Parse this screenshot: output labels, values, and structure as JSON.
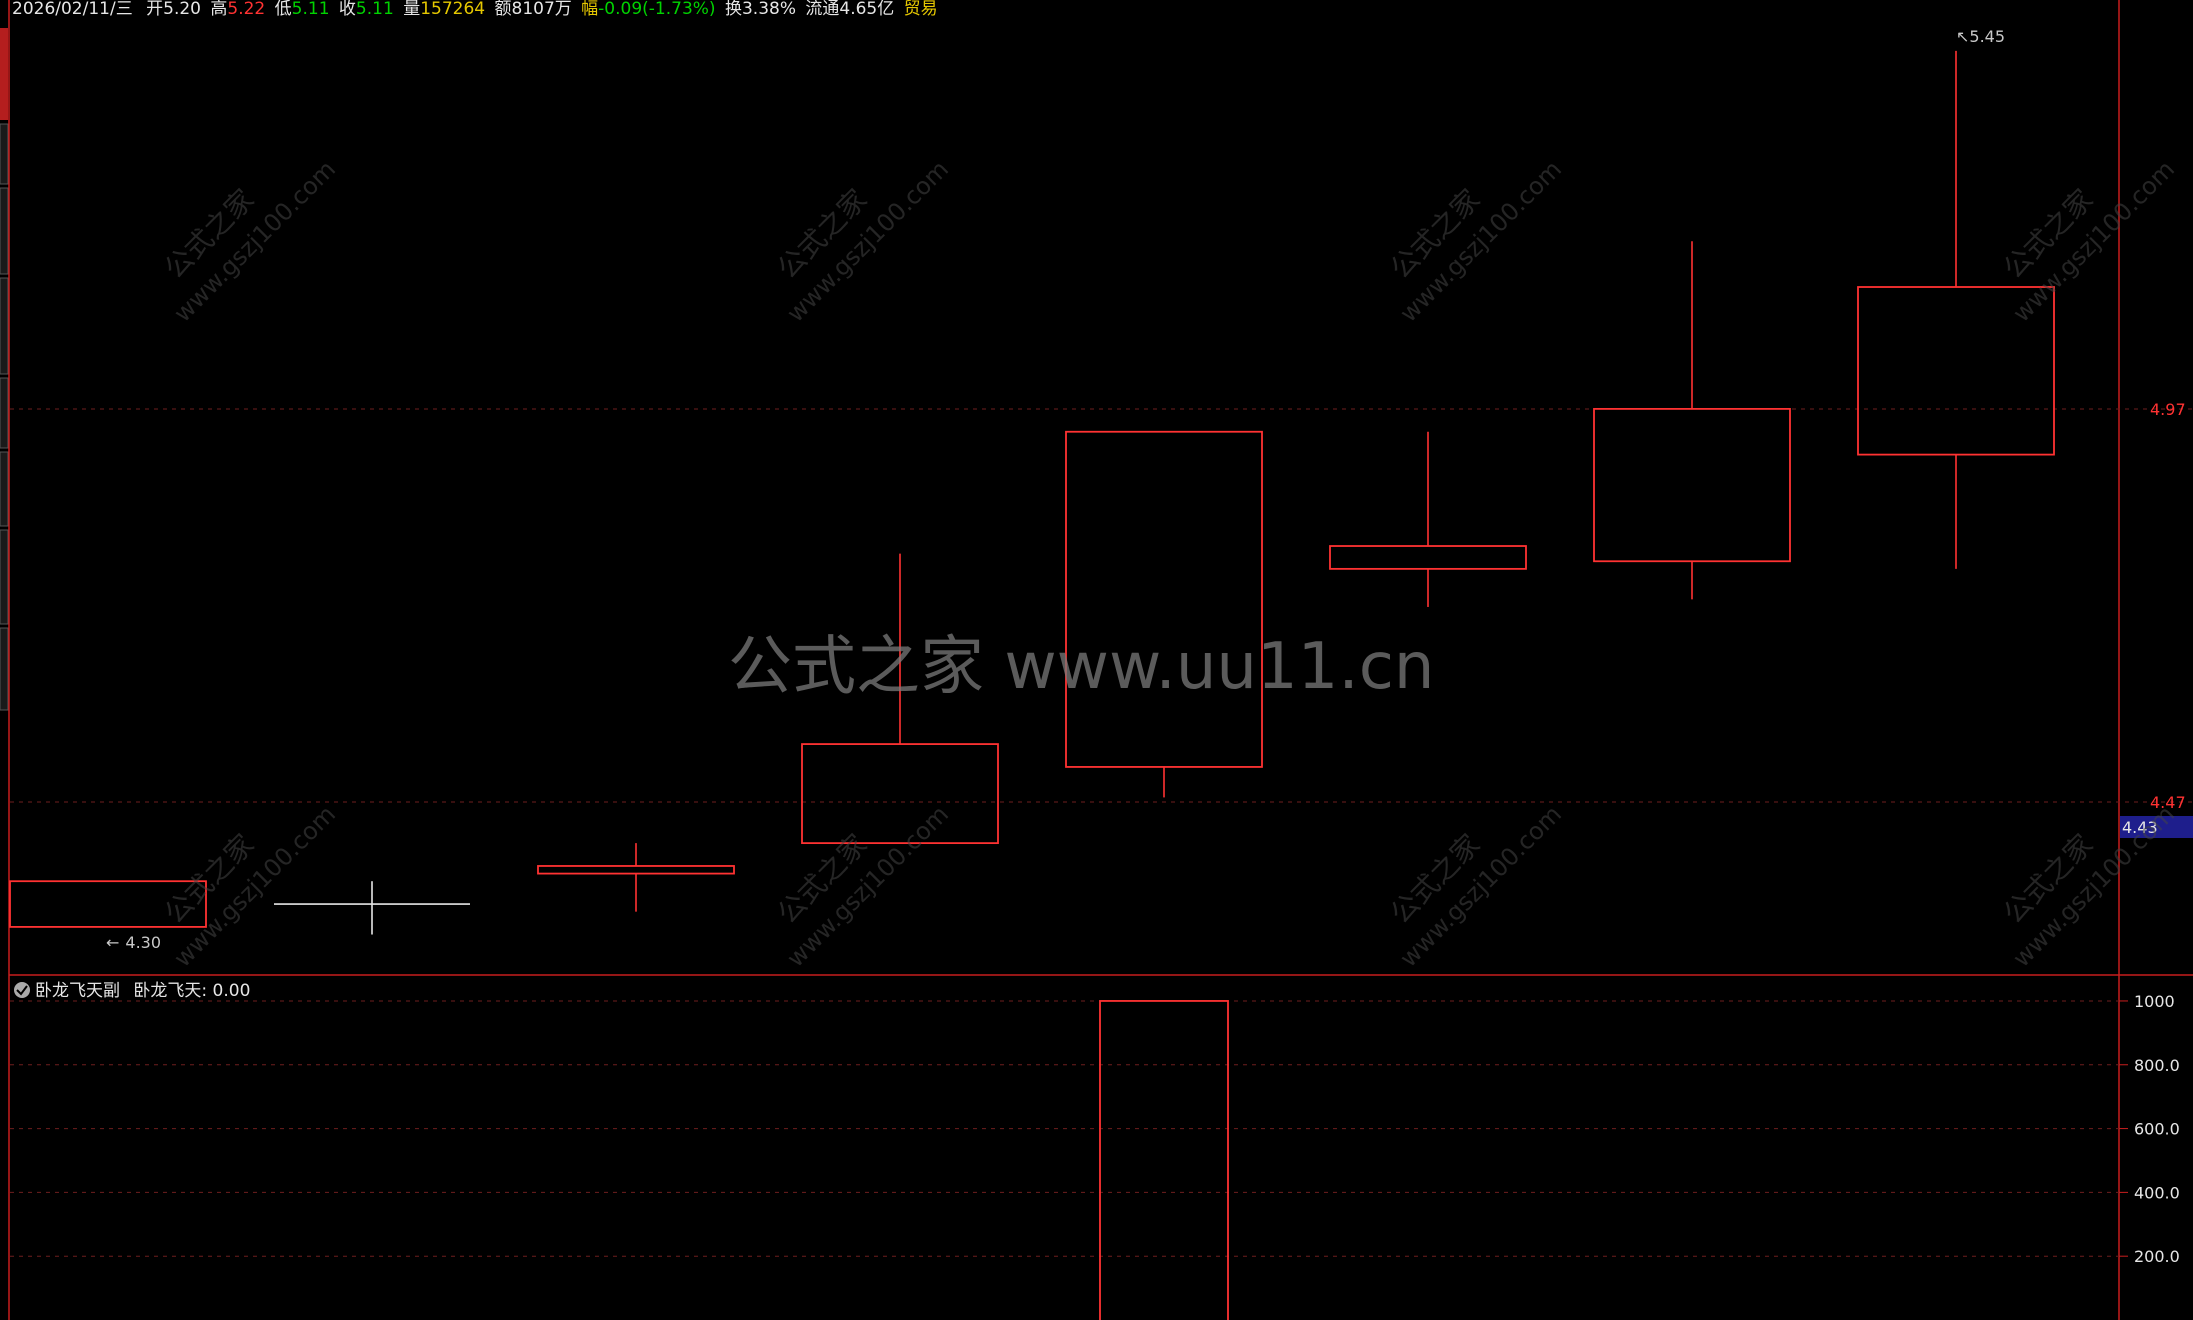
{
  "info_bar": {
    "date": "2026/02/11/三",
    "open_label": "开",
    "open_value": "5.20",
    "high_label": "高",
    "high_value": "5.22",
    "low_label": "低",
    "low_value": "5.11",
    "close_label": "收",
    "close_value": "5.11",
    "volume_label": "量",
    "volume_value": "157264",
    "amount_label": "额",
    "amount_value": "8107万",
    "change_label": "幅",
    "change_value": "-0.09(-1.73%)",
    "turnover_label": "换",
    "turnover_value": "3.38%",
    "float_label": "流通",
    "float_value": "4.65亿",
    "sector": "贸易"
  },
  "price_axis": {
    "labels": [
      "4.97",
      "4.47"
    ],
    "current_price_tag": "4.43"
  },
  "markers": {
    "high": "5.45",
    "low": "4.30"
  },
  "indicator": {
    "name": "卧龙飞天副",
    "series_label": "卧龙飞天: 0.00",
    "axis_labels": [
      "1000",
      "800.0",
      "600.0",
      "400.0",
      "200.0"
    ]
  },
  "watermarks": {
    "small_cn": "公式之家",
    "small_url": "www.gszj100.com",
    "big": "公式之家 www.uu11.cn"
  },
  "colors": {
    "up": "#ff3232",
    "down": "#00c8c8",
    "frame": "#c81e1e",
    "grid": "#6e1e1e",
    "text_white": "#e6e6e6",
    "text_yellow": "#e6c800",
    "text_green": "#00d200",
    "text_red": "#ff3232",
    "price_tag_bg": "#1e1e8c"
  },
  "chart_data": {
    "type": "candlestick",
    "price_ylim": [
      4.25,
      5.48
    ],
    "candles": [
      {
        "open": 4.3,
        "close": 4.36,
        "high": 4.36,
        "low": 4.3
      },
      {
        "open": 4.33,
        "close": 4.33,
        "high": 4.36,
        "low": 4.29
      },
      {
        "open": 4.37,
        "close": 4.38,
        "high": 4.41,
        "low": 4.32
      },
      {
        "open": 4.41,
        "close": 4.54,
        "high": 4.79,
        "low": 4.41
      },
      {
        "open": 4.51,
        "close": 4.95,
        "high": 4.95,
        "low": 4.47
      },
      {
        "open": 4.77,
        "close": 4.8,
        "high": 4.95,
        "low": 4.72
      },
      {
        "open": 4.78,
        "close": 4.98,
        "high": 5.2,
        "low": 4.73
      },
      {
        "open": 4.92,
        "close": 5.14,
        "high": 5.45,
        "low": 4.77
      }
    ],
    "indicator_ylim": [
      0,
      1050
    ],
    "indicator_values": [
      0,
      0,
      0,
      0,
      1000,
      0,
      0,
      0
    ]
  }
}
